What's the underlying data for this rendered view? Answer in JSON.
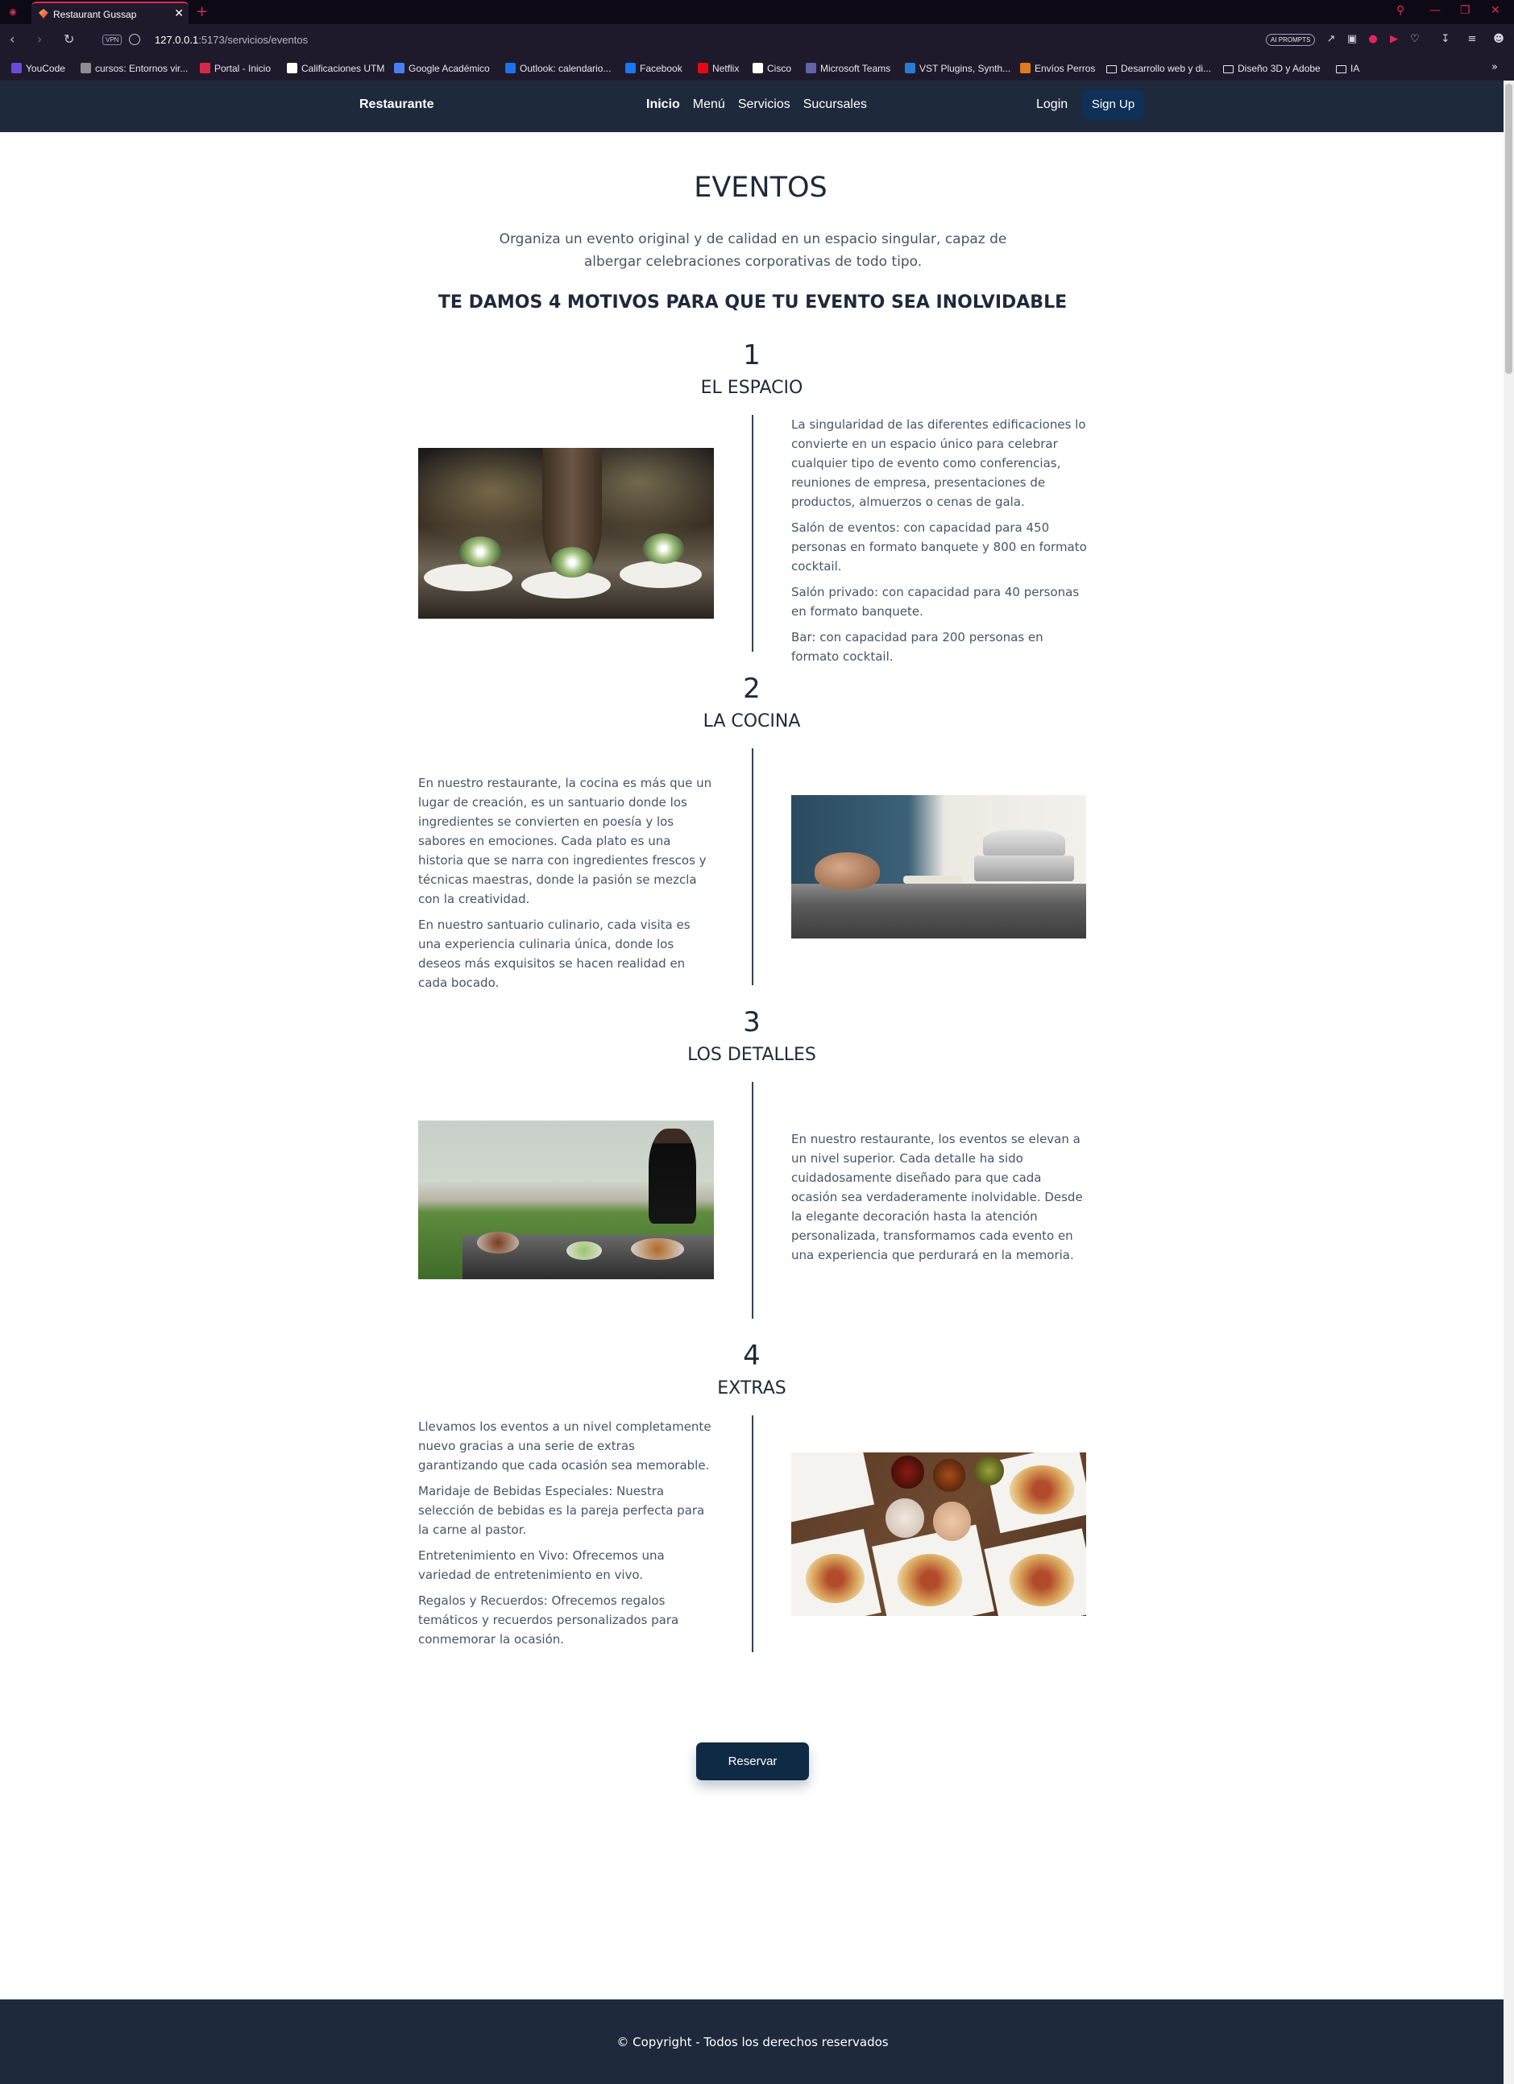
{
  "browser": {
    "tab_title": "Restaurant Gussap",
    "url_host": "127.0.0.1",
    "url_rest": ":5173/servicios/eventos",
    "vpn_label": "VPN",
    "ai_prompts_label": "AI PROMPTS",
    "bookmarks": [
      {
        "label": "YouCode",
        "color": "#6b4cd6"
      },
      {
        "label": "cursos: Entornos vir...",
        "color": "#8d8d8d"
      },
      {
        "label": "Portal - Inicio",
        "color": "#d6294a"
      },
      {
        "label": "Calificaciones UTM",
        "color": "#ffffff"
      },
      {
        "label": "Google Académico",
        "color": "#4a7df0"
      },
      {
        "label": "Outlook: calendario...",
        "color": "#1a73e8"
      },
      {
        "label": "Facebook",
        "color": "#1877f2"
      },
      {
        "label": "Netflix",
        "color": "#e50914"
      },
      {
        "label": "Cisco",
        "color": "#ffffff"
      },
      {
        "label": "Microsoft Teams",
        "color": "#6264a7"
      },
      {
        "label": "VST Plugins, Synth...",
        "color": "#2b7bd6"
      },
      {
        "label": "Envíos Perros",
        "color": "#e07a1f"
      },
      {
        "label": "Desarrollo web y di...",
        "color": "#1f1a2b"
      },
      {
        "label": "Diseño 3D y Adobe",
        "color": "#1f1a2b"
      },
      {
        "label": "IA",
        "color": "#1f1a2b"
      }
    ],
    "bookmarks_more": "»"
  },
  "site": {
    "brand": "Restaurante",
    "nav": [
      "Inicio",
      "Menú",
      "Servicios",
      "Sucursales"
    ],
    "login": "Login",
    "signup": "Sign Up"
  },
  "page": {
    "title": "EVENTOS",
    "intro": "Organiza un evento original y de calidad en un espacio singular, capaz de albergar celebraciones corporativas de todo tipo.",
    "subheading": "TE DAMOS 4 MOTIVOS PARA QUE TU EVENTO SEA INOLVIDABLE",
    "sections": [
      {
        "number": "1",
        "title": "EL ESPACIO",
        "image": "banquet-hall-photo",
        "paragraphs": [
          "La singularidad de las diferentes edificaciones lo convierte en un espacio único para celebrar cualquier tipo de evento como conferencias, reuniones de empresa, presentaciones de productos, almuerzos o cenas de gala.",
          "Salón de eventos: con capacidad para 450 personas en formato banquete y 800 en formato cocktail.",
          "Salón privado: con capacidad para 40 personas en formato banquete.",
          "Bar: con capacidad para 200 personas en formato cocktail."
        ]
      },
      {
        "number": "2",
        "title": "LA COCINA",
        "image": "kitchen-buffet-photo",
        "paragraphs": [
          "En nuestro restaurante, la cocina es más que un lugar de creación, es un santuario donde los ingredientes se convierten en poesía y los sabores en emociones. Cada plato es una historia que se narra con ingredientes frescos y técnicas maestras, donde la pasión se mezcla con la creatividad.",
          "En nuestro santuario culinario, cada visita es una experiencia culinaria única, donde los deseos más exquisitos se hacen realidad en cada bocado."
        ]
      },
      {
        "number": "3",
        "title": "LOS DETALLES",
        "image": "chef-outdoor-photo",
        "paragraphs": [
          "En nuestro restaurante, los eventos se elevan a un nivel superior. Cada detalle ha sido cuidadosamente diseñado para que cada ocasión sea verdaderamente inolvidable. Desde la elegante decoración hasta la atención personalizada, transformamos cada evento en una experiencia que perdurará en la memoria."
        ]
      },
      {
        "number": "4",
        "title": "EXTRAS",
        "image": "tacos-plates-photo",
        "paragraphs": [
          "Llevamos los eventos a un nivel completamente nuevo gracias a una serie de extras garantizando que cada ocasión sea memorable.",
          "Maridaje de Bebidas Especiales: Nuestra selección de bebidas es la pareja perfecta para la carne al pastor.",
          "Entretenimiento en Vivo: Ofrecemos una variedad de entretenimiento en vivo.",
          "Regalos y Recuerdos: Ofrecemos regalos temáticos y recuerdos personalizados para conmemorar la ocasión."
        ]
      }
    ],
    "reserve_button": "Reservar",
    "footer": "© Copyright - Todos los derechos reservados"
  }
}
